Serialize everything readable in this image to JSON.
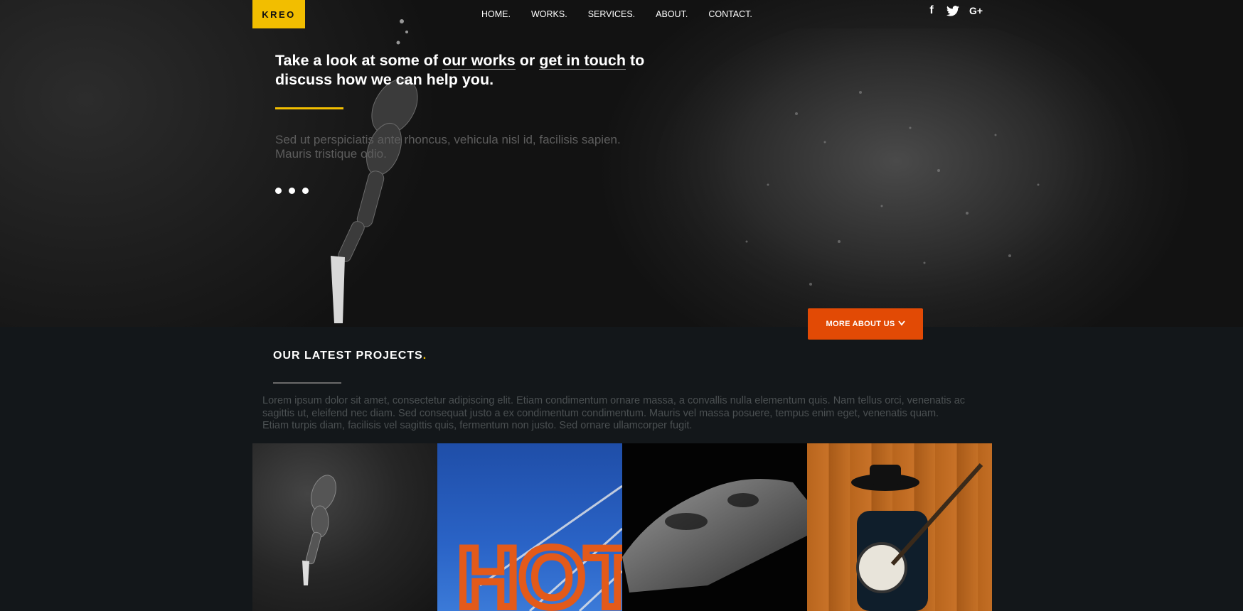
{
  "brand": {
    "logo_text": "KREO",
    "accent": "#f2be00",
    "button_color": "#e24a05"
  },
  "nav": [
    {
      "label": "HOME."
    },
    {
      "label": "WORKS."
    },
    {
      "label": "SERVICES."
    },
    {
      "label": "ABOUT."
    },
    {
      "label": "CONTACT."
    }
  ],
  "social": [
    "facebook-icon",
    "twitter-icon",
    "google-plus-icon"
  ],
  "social_labels": {
    "facebook": "f",
    "google_plus": "G+"
  },
  "hero": {
    "headline_part1": "Take a look at some of ",
    "headline_link1": "our works",
    "headline_part2": " or ",
    "headline_link2": "get in touch",
    "headline_part3": " to discuss how we can help you.",
    "subtext": "Sed ut perspiciatis ante rhoncus, vehicula nisl id, facilisis sapien. Mauris tristique odio.",
    "slides": 3,
    "cta_label": "MORE ABOUT US",
    "cta_icon": "chevron-down-icon"
  },
  "projects_section": {
    "title": "OUR LATEST PROJECTS",
    "title_dot": ".",
    "body": "Lorem ipsum dolor sit amet, consectetur adipiscing elit. Etiam condimentum ornare massa, a convallis nulla elementum quis. Nam tellus orci, venenatis ac sagittis ut, eleifend nec diam. Sed consequat justo a ex condimentum condimentum. Mauris vel massa posuere, tempus enim eget, venenatis quam. Etiam turpis diam, facilisis vel sagittis quis, fermentum non justo. Sed ornare ullamcorper fugit.",
    "tiles": [
      {
        "name": "project-diver"
      },
      {
        "name": "project-hotel-sign",
        "sign_text": "HOT"
      },
      {
        "name": "project-car"
      },
      {
        "name": "project-banjo"
      }
    ]
  }
}
